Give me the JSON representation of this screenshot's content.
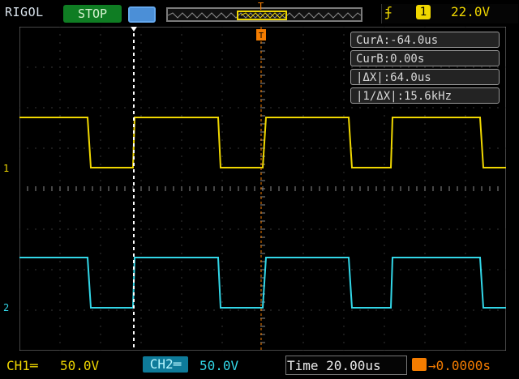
{
  "top": {
    "brand": "RIGOL",
    "run_state": "STOP",
    "trigger_source": "1",
    "trigger_level": "22.0V",
    "trigger_edge_icon": "rising-edge-icon"
  },
  "cursor_readout": {
    "cur_a": "CurA:-64.0us",
    "cur_b": "CurB:0.00s",
    "delta_x": "|ΔX|:64.0us",
    "inv_delta_x": "|1/ΔX|:15.6kHz"
  },
  "channels": {
    "ch1": {
      "label": "CH1═",
      "scale": "50.0V",
      "marker": "1",
      "color": "#f0d700"
    },
    "ch2": {
      "label": "CH2═",
      "scale": "50.0V",
      "marker": "2",
      "color": "#32d7e8"
    }
  },
  "bottom": {
    "time_base": "Time 20.00us",
    "trigger_position": "→0.0000s"
  },
  "colors": {
    "ch1": "#f0d700",
    "ch2": "#32d7e8",
    "trigger": "#f47c00",
    "stop": "#0f7d23"
  }
}
